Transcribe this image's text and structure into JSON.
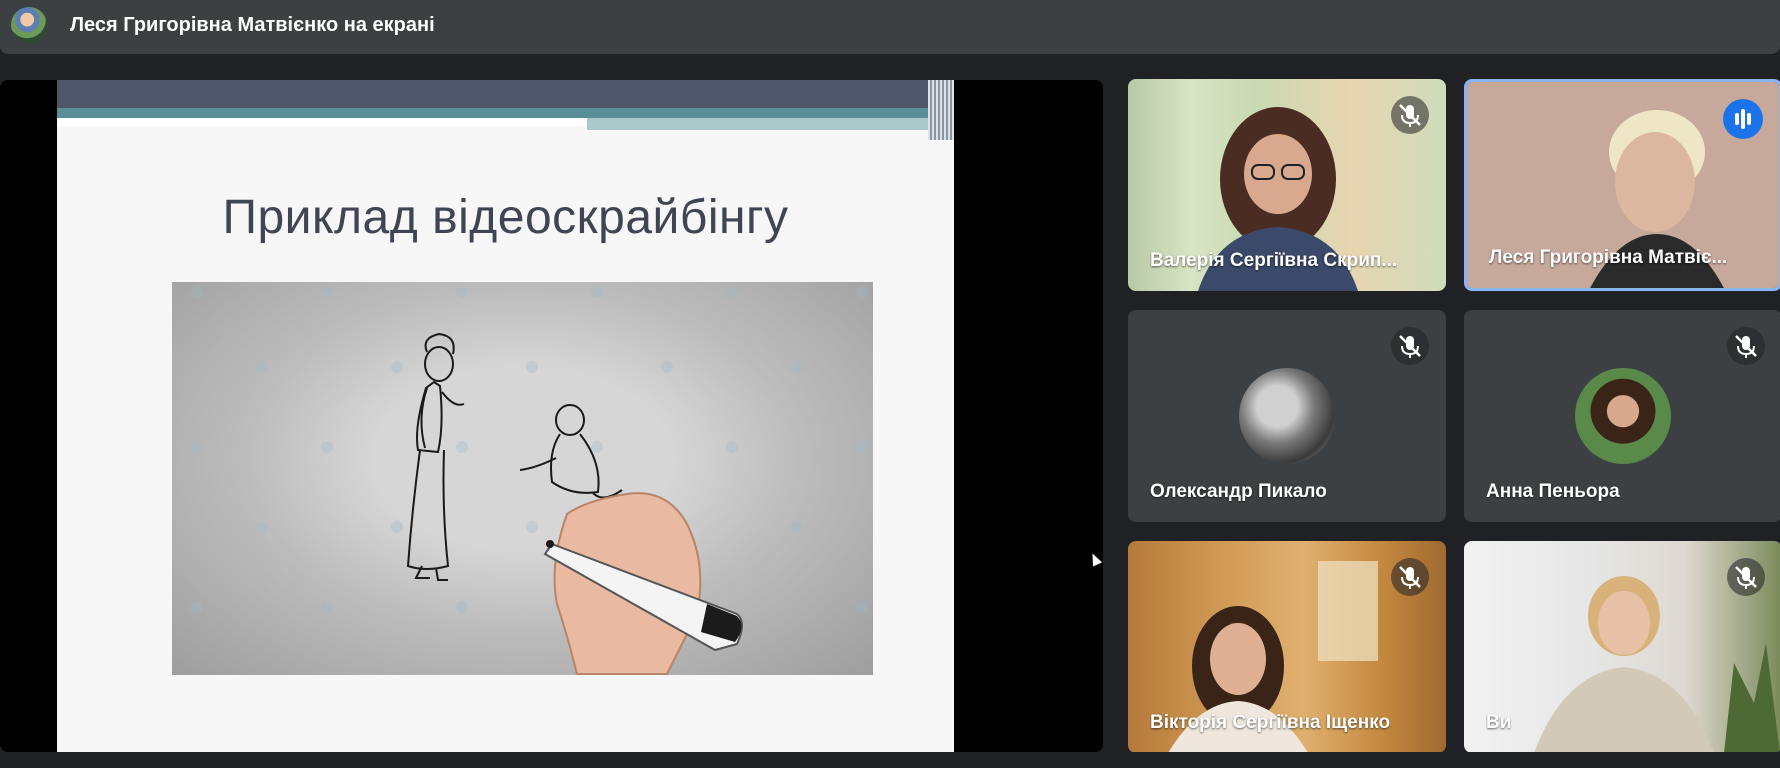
{
  "header": {
    "presenter_title": "Леся Григорівна Матвієнко на екрані",
    "avatar_icon": "presenter-avatar"
  },
  "presentation": {
    "slide_title": "Приклад відеоскрайбінгу",
    "content": "whiteboard-animation-video"
  },
  "participants": [
    {
      "name": "Валерія Сергіївна Скрип...",
      "mic": "muted",
      "video": "camera",
      "active_speaker": false
    },
    {
      "name": "Леся Григорівна Матвіє...",
      "mic": "speaking",
      "video": "camera",
      "active_speaker": true
    },
    {
      "name": "Олександр Пикало",
      "mic": "muted",
      "video": "avatar",
      "active_speaker": false
    },
    {
      "name": "Анна Пеньора",
      "mic": "muted",
      "video": "avatar",
      "active_speaker": false
    },
    {
      "name": "Вікторія Сергіївна Іщенко",
      "mic": "muted",
      "video": "camera",
      "active_speaker": false
    },
    {
      "name": "Ви",
      "mic": "muted",
      "video": "camera",
      "active_speaker": false
    }
  ],
  "colors": {
    "background": "#202124",
    "tile": "#3c4043",
    "active_border": "#8ab4f8",
    "speaking": "#1a73e8"
  },
  "icons": [
    "mic-off-icon",
    "speaking-indicator-icon",
    "mouse-pointer-icon"
  ]
}
